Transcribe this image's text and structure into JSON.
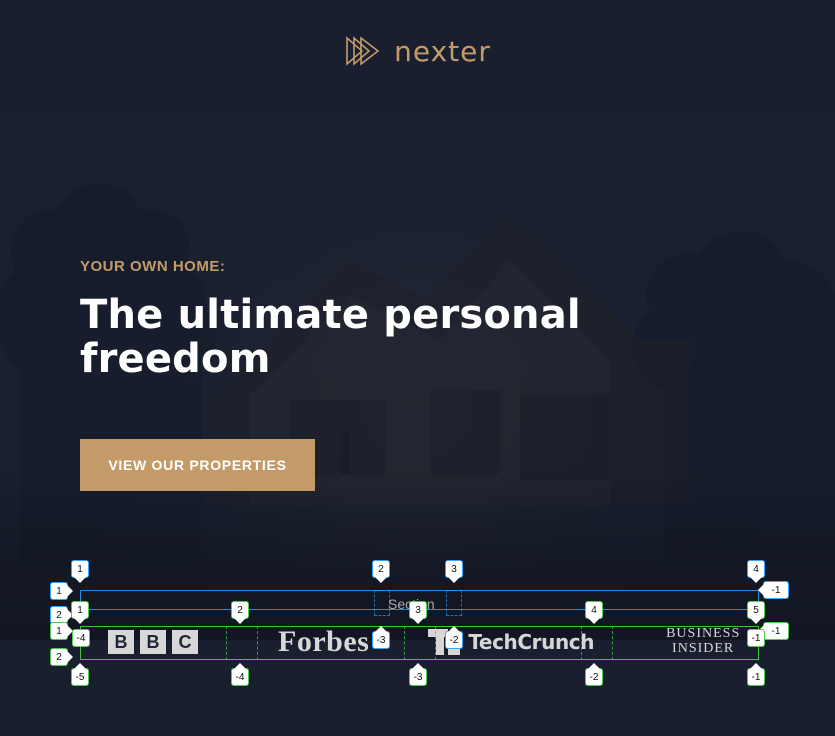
{
  "brand": {
    "name": "nexter",
    "accent_color": "#c39b68",
    "logo_icon": "triangles-play-icon"
  },
  "hero": {
    "subtitle": "YOUR OWN HOME:",
    "title": "The ultimate personal freedom",
    "cta_label": "VIEW OUR PROPERTIES"
  },
  "press": {
    "logos": [
      {
        "name": "BBC",
        "icon": "bbc-logo"
      },
      {
        "name": "Forbes",
        "icon": "forbes-logo"
      },
      {
        "name": "TechCrunch",
        "icon": "techcrunch-logo"
      },
      {
        "name": "BUSINESS INSIDER",
        "icon": "business-insider-logo"
      }
    ]
  },
  "builder_overlay": {
    "section_label": "Section",
    "markers_top": [
      "1",
      "2",
      "3",
      "4"
    ],
    "markers_left": [
      "1",
      "2",
      "1",
      "2"
    ],
    "markers_right": [
      "-1",
      "-1"
    ],
    "markers_mid_top": [
      "1",
      "2",
      "3",
      "4",
      "5"
    ],
    "markers_mid_bottom_blue": [
      "-3",
      "-2"
    ],
    "markers_bottom_green": [
      "-5",
      "-4",
      "-3",
      "-2",
      "-1"
    ],
    "markers_inline_green_left": [
      "-4"
    ],
    "markers_inline_green_right": [
      "-1"
    ]
  }
}
